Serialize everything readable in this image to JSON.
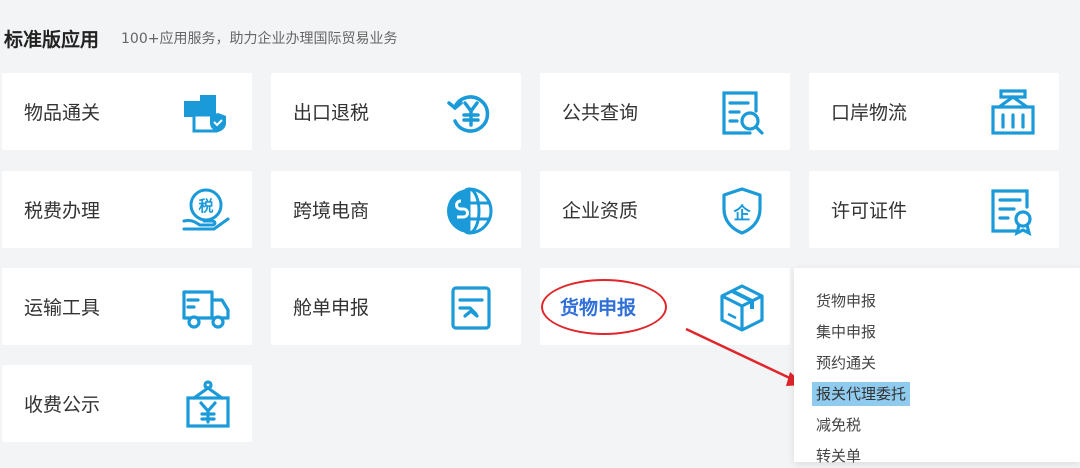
{
  "header": {
    "title": "标准版应用",
    "subtitle": "100+应用服务，助力企业办理国际贸易业务"
  },
  "tiles": [
    {
      "label": "物品通关",
      "icon": "goods-customs-icon"
    },
    {
      "label": "出口退税",
      "icon": "export-tax-refund-icon"
    },
    {
      "label": "公共查询",
      "icon": "public-query-icon"
    },
    {
      "label": "口岸物流",
      "icon": "port-logistics-icon"
    },
    {
      "label": "税费办理",
      "icon": "tax-payment-icon"
    },
    {
      "label": "跨境电商",
      "icon": "cross-border-ecommerce-icon"
    },
    {
      "label": "企业资质",
      "icon": "enterprise-qualification-icon"
    },
    {
      "label": "许可证件",
      "icon": "license-certificate-icon"
    },
    {
      "label": "运输工具",
      "icon": "transport-truck-icon"
    },
    {
      "label": "舱单申报",
      "icon": "manifest-declaration-icon"
    },
    {
      "label": "货物申报",
      "icon": "cargo-declaration-icon"
    },
    {
      "label": "收费公示",
      "icon": "fee-notice-icon"
    }
  ],
  "cargo_menu": {
    "items": [
      "货物申报",
      "集中申报",
      "预约通关",
      "报关代理委托",
      "减免税",
      "转关单"
    ],
    "highlighted_index": 3
  },
  "colors": {
    "icon_blue": "#1a9ad9",
    "active_label": "#2f6fd8",
    "annotation_red": "#e0252b",
    "highlight_bg": "#8fcbef"
  }
}
